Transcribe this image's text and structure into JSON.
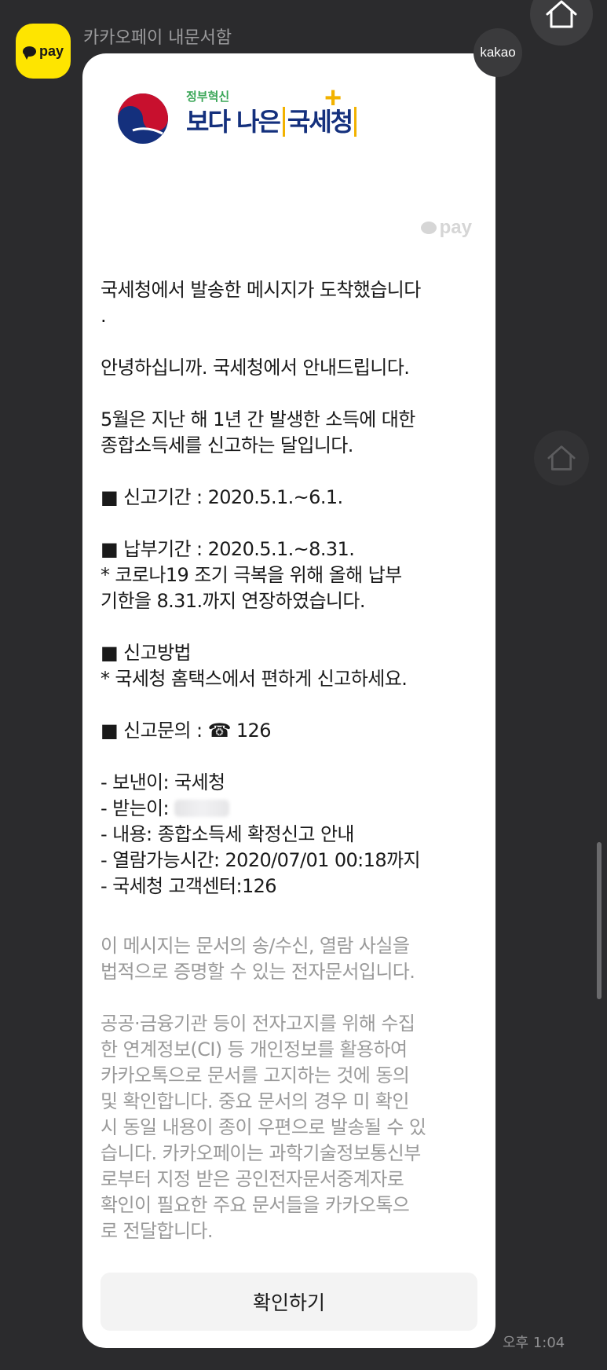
{
  "chat": {
    "sender_name": "카카오페이 내문서함",
    "avatar_label": "pay",
    "kakao_badge": "kakao",
    "timestamp": "오후 1:04"
  },
  "logo": {
    "subtitle": "정부혁신",
    "title_prefix": "보다 나은",
    "title_bracketed": "국세청",
    "plus": "+",
    "brand_colors": {
      "navy": "#14307d",
      "green": "#3aa657",
      "gold": "#f2b200",
      "red": "#c8102e"
    }
  },
  "pay_mark": "pay",
  "message": {
    "l1": "국세청에서 발송한 메시지가 도착했습니다",
    "l2": ".",
    "l3": "안녕하십니까. 국세청에서 안내드립니다.",
    "l4": "5월은 지난 해 1년 간 발생한 소득에 대한",
    "l5": "종합소득세를 신고하는 달입니다.",
    "l6": "■ 신고기간 : 2020.5.1.~6.1.",
    "l7": "■ 납부기간 : 2020.5.1.~8.31.",
    "l8": "  * 코로나19 조기 극복을 위해 올해 납부",
    "l9": "기한을 8.31.까지 연장하였습니다.",
    "l10": "■ 신고방법",
    "l11": "  * 국세청 홈택스에서 편하게 신고하세요.",
    "l12": "■ 신고문의 : ☎ 126",
    "l13": "- 보낸이: 국세청",
    "l14": "- 받는이: ",
    "l15": "- 내용: 종합소득세 확정신고 안내",
    "l16": "- 열람가능시간: 2020/07/01 00:18까지",
    "l17": "- 국세청 고객센터:126"
  },
  "notice": {
    "l1": "이 메시지는 문서의 송/수신, 열람 사실을",
    "l2": "법적으로 증명할 수 있는 전자문서입니다.",
    "l3": "공공·금융기관 등이 전자고지를 위해 수집",
    "l4": "한 연계정보(CI) 등 개인정보를 활용하여",
    "l5": "카카오톡으로 문서를 고지하는 것에 동의",
    "l6": "및 확인합니다. 중요 문서의 경우 미 확인",
    "l7": "시 동일 내용이 종이 우편으로 발송될 수 있",
    "l8": "습니다. 카카오페이는 과학기술정보통신부",
    "l9": "로부터 지정 받은 공인전자문서중계자로",
    "l10": "확인이 필요한 주요 문서들을 카카오톡으",
    "l11": "로 전달합니다."
  },
  "confirm_button": "확인하기",
  "icons": {
    "home": "home-icon",
    "pay_bubble": "speech-bubble-icon",
    "phone": "telephone-icon"
  }
}
